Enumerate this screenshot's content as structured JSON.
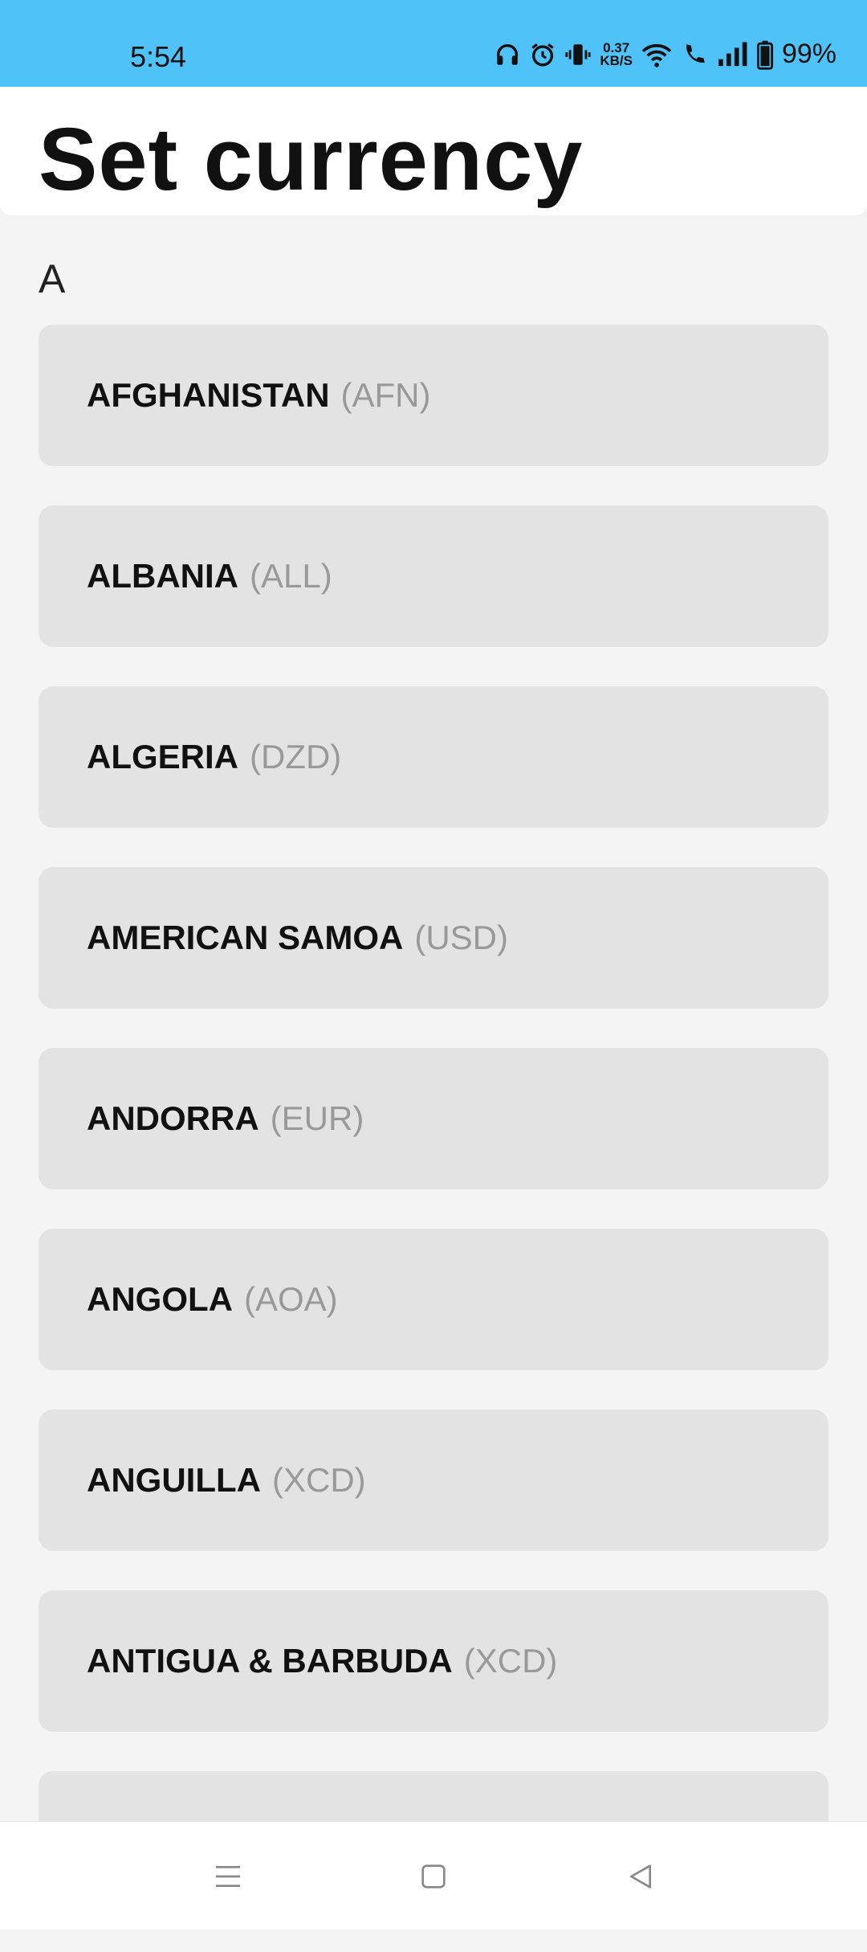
{
  "status": {
    "time": "5:54",
    "net_speed_value": "0.37",
    "net_speed_unit": "KB/S",
    "battery": "99%",
    "icons": [
      "headphones-icon",
      "alarm-icon",
      "vibrate-icon",
      "wifi-icon",
      "wifi-call-icon",
      "signal-icon",
      "battery-icon"
    ]
  },
  "header": {
    "title": "Set currency"
  },
  "section": {
    "letter": "A"
  },
  "countries": [
    {
      "name": "AFGHANISTAN",
      "code": "(AFN)"
    },
    {
      "name": "ALBANIA",
      "code": "(ALL)"
    },
    {
      "name": "ALGERIA",
      "code": "(DZD)"
    },
    {
      "name": "AMERICAN SAMOA",
      "code": "(USD)"
    },
    {
      "name": "ANDORRA",
      "code": "(EUR)"
    },
    {
      "name": "ANGOLA",
      "code": "(AOA)"
    },
    {
      "name": "ANGUILLA",
      "code": "(XCD)"
    },
    {
      "name": "ANTIGUA & BARBUDA",
      "code": "(XCD)"
    },
    {
      "name": "",
      "code": ""
    }
  ],
  "nav": {
    "icons": [
      "menu-icon",
      "home-icon",
      "back-icon"
    ]
  },
  "colors": {
    "status_bar": "#4fc3f7",
    "card": "#e3e3e3",
    "background": "#f4f4f4",
    "code_text": "#999999"
  }
}
